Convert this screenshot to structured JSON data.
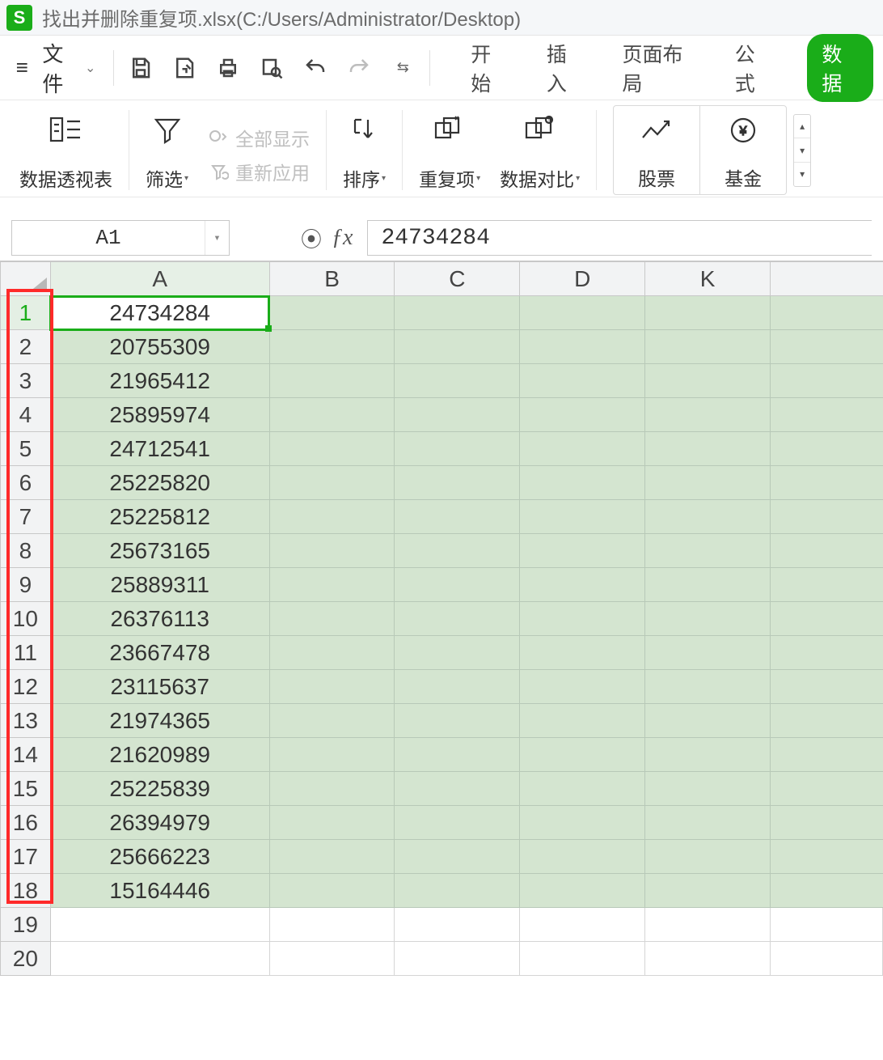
{
  "title": "找出并删除重复项.xlsx(C:/Users/Administrator/Desktop)",
  "app_icon_text": "S",
  "file_menu": {
    "label": "文件"
  },
  "tabs": {
    "start": "开始",
    "insert": "插入",
    "layout": "页面布局",
    "formula": "公式",
    "data": "数据"
  },
  "ribbon": {
    "pivot": "数据透视表",
    "filter": "筛选",
    "show_all": "全部显示",
    "reapply": "重新应用",
    "sort": "排序",
    "duplicates": "重复项",
    "compare": "数据对比",
    "stock": "股票",
    "fund": "基金"
  },
  "namebox": "A1",
  "formula_value": "24734284",
  "columns": [
    "A",
    "B",
    "C",
    "D",
    "K"
  ],
  "rows": [
    {
      "n": 1,
      "a": "24734284",
      "selected": true,
      "hl": true
    },
    {
      "n": 2,
      "a": "20755309",
      "hl": true
    },
    {
      "n": 3,
      "a": "21965412",
      "hl": true
    },
    {
      "n": 4,
      "a": "25895974",
      "hl": true
    },
    {
      "n": 5,
      "a": "24712541",
      "hl": true
    },
    {
      "n": 6,
      "a": "25225820",
      "hl": true
    },
    {
      "n": 7,
      "a": "25225812",
      "hl": true
    },
    {
      "n": 8,
      "a": "25673165",
      "hl": true
    },
    {
      "n": 9,
      "a": "25889311",
      "hl": true
    },
    {
      "n": 10,
      "a": "26376113",
      "hl": true
    },
    {
      "n": 11,
      "a": "23667478",
      "hl": true
    },
    {
      "n": 12,
      "a": "23115637",
      "hl": true
    },
    {
      "n": 13,
      "a": "21974365",
      "hl": true
    },
    {
      "n": 14,
      "a": "21620989",
      "hl": true
    },
    {
      "n": 15,
      "a": "25225839",
      "hl": true
    },
    {
      "n": 16,
      "a": "26394979",
      "hl": true
    },
    {
      "n": 17,
      "a": "25666223",
      "hl": true
    },
    {
      "n": 18,
      "a": "15164446",
      "hl": true
    },
    {
      "n": 19,
      "a": "",
      "hl": false
    },
    {
      "n": 20,
      "a": "",
      "hl": false
    }
  ]
}
